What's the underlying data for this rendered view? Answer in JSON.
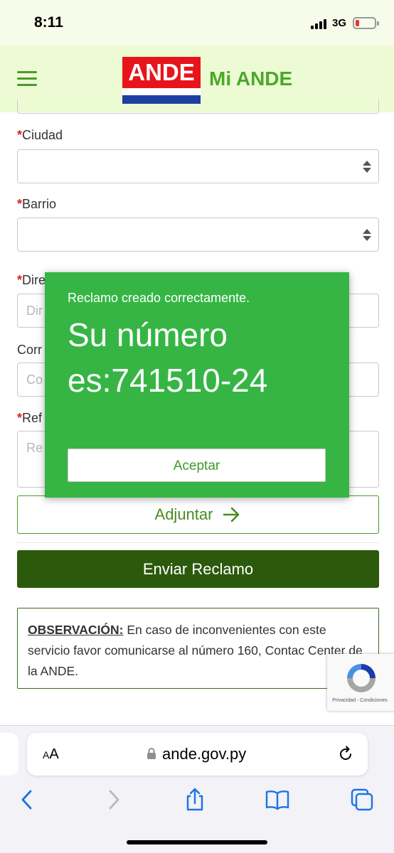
{
  "status_bar": {
    "time": "8:11",
    "network": "3G"
  },
  "header": {
    "logo_text": "ANDE",
    "title": "Mi ANDE"
  },
  "form": {
    "required_mark": "*",
    "ciudad_label": "Ciudad",
    "barrio_label": "Barrio",
    "direccion_label_partial": "Dire",
    "direccion_placeholder_partial": "Dir",
    "correo_label_partial": "Corr",
    "correo_placeholder_partial": "Co",
    "referencia_label_partial": "Ref",
    "referencia_placeholder_partial": "Re",
    "adjuntar_label": "Adjuntar",
    "enviar_label": "Enviar Reclamo"
  },
  "observacion": {
    "title": "OBSERVACIÓN:",
    "text": " En caso de inconvenientes con este servicio favor comunicarse al número 160, Contac Center de la ANDE."
  },
  "recaptcha": {
    "terms": "Privacidad - Condiciones"
  },
  "modal": {
    "subtitle": "Reclamo creado correctamente.",
    "message": "Su número es:741510-24",
    "accept_label": "Aceptar"
  },
  "browser": {
    "text_size_label_small": "A",
    "text_size_label_big": "A",
    "url": "ande.gov.py"
  },
  "colors": {
    "header_bg": "#ecfbd4",
    "brand_green": "#4ca82a",
    "modal_green": "#36b545",
    "submit_dark_green": "#2b5a0c",
    "logo_red": "#e8141c",
    "logo_blue": "#1f3fa0"
  }
}
